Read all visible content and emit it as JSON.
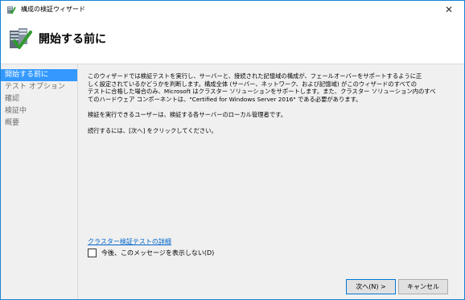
{
  "window": {
    "title": "構成の検証ウィザード",
    "close_glyph": "✕"
  },
  "header": {
    "title": "開始する前に"
  },
  "sidebar": {
    "steps": [
      {
        "label": "開始する前に",
        "active": true
      },
      {
        "label": "テスト オプション",
        "active": false
      },
      {
        "label": "確認",
        "active": false
      },
      {
        "label": "検証中",
        "active": false
      },
      {
        "label": "概要",
        "active": false
      }
    ]
  },
  "content": {
    "intro_line1": "このウィザードでは検証テストを実行し、サーバーと、接続された記憶域の構成が、フェールオーバーをサポートするように正",
    "intro_line2": "しく設定されているかどうかを判断します。構成全体 (サーバー、ネットワーク、および記憶域) がこのウィザードのすべての",
    "intro_line3": "テストに合格した場合のみ、Microsoft はクラスター ソリューションをサポートします。また、クラスター ソリューション内のすべ",
    "intro_line4": "てのハードウェア コンポーネントは、\"Certified for Windows Server 2016\" である必要があります。",
    "admin_note": "検証を実行できるユーザーは、検証する各サーバーのローカル管理者です。",
    "continue_note": "続行するには、[次へ] をクリックしてください。",
    "details_link": "クラスター検証テストの詳細",
    "dont_show_label": "今後、このメッセージを表示しない(D)",
    "dont_show_checked": false
  },
  "buttons": {
    "next": "次へ(N) >",
    "cancel": "キャンセル"
  },
  "colors": {
    "accent": "#3399ff",
    "link": "#0066cc",
    "border": "#1883d7"
  }
}
